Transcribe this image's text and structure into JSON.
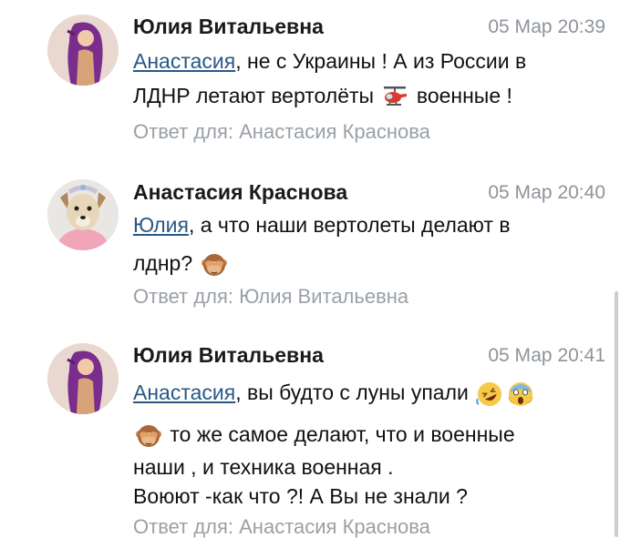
{
  "comments": [
    {
      "author": "Юлия Витальевна",
      "time": "05 Мар 20:39",
      "mention": "Анастасия",
      "line1_rest": ", не с Украины ! А из России в",
      "line2_start": "ЛДНР летают вертолёты ",
      "line2_end": " военные !",
      "reply": "Ответ для: Анастасия Краснова"
    },
    {
      "author": "Анастасия Краснова",
      "time": "05 Мар 20:40",
      "mention": "Юлия",
      "line1_rest": ", а что наши вертолеты делают в",
      "line2_start": "лднр? ",
      "reply": "Ответ для: Юлия Витальевна"
    },
    {
      "author": "Юлия Витальевна",
      "time": "05 Мар 20:41",
      "mention": "Анастасия",
      "line1_rest": ", вы будто с луны упали ",
      "line2_rest": " то же самое делают, что и военные",
      "line3": "наши , и техника военная .",
      "line4": "Воюют -как что ?! А Вы не знали ?",
      "reply": "Ответ для: Анастасия Краснова"
    }
  ],
  "icons": [
    "helicopter-emoji",
    "see-no-evil-monkey-emoji",
    "rofl-emoji",
    "screaming-face-emoji"
  ],
  "colors": {
    "mention": "#2a5885",
    "meta": "#8e949a",
    "reply": "#9aa0a6"
  }
}
